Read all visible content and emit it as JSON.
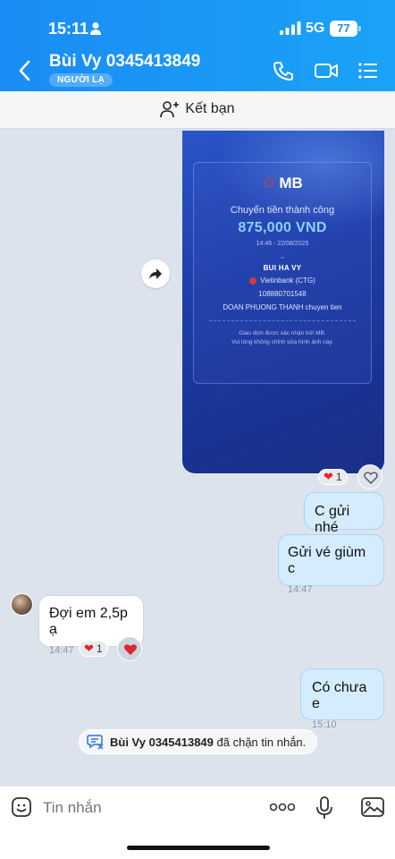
{
  "status_bar": {
    "time": "15:11",
    "network": "5G",
    "battery": "77"
  },
  "header": {
    "title": "Bùi Vy 0345413849",
    "badge": "NGƯỜI LẠ"
  },
  "friend_bar": {
    "label": "Kết bạn"
  },
  "receipt": {
    "bank_logo": "MB",
    "status": "Chuyển tiền thành công",
    "amount": "875,000 VND",
    "datetime": "14:46 - 22/08/2025",
    "recipient": "BUI HA VY",
    "bank": "Vietinbank (CTG)",
    "account": "108880701548",
    "note": "DOAN PHUONG THANH chuyen tien",
    "footer_1": "Giao dịch được xác nhận bởi MB.",
    "footer_2": "Vui lòng không chỉnh sửa hình ảnh này.",
    "reaction_count": "1"
  },
  "messages": [
    {
      "text": "C gửi nhé",
      "time": ""
    },
    {
      "text": "Gửi vé giùm c",
      "time": "14:47"
    },
    {
      "text": "Đợi em 2,5p ạ",
      "time": "14:47",
      "reaction_count": "1"
    },
    {
      "text": "Có chưa e",
      "time": "15:10"
    }
  ],
  "system_notice": {
    "name": "Bùi Vy 0345413849",
    "text": "đã chặn tin nhắn."
  },
  "composer": {
    "placeholder": "Tin nhắn"
  },
  "colors": {
    "header": "#1a8cf5",
    "sent_bubble": "#d4ecfd",
    "heart": "#e0262f"
  }
}
